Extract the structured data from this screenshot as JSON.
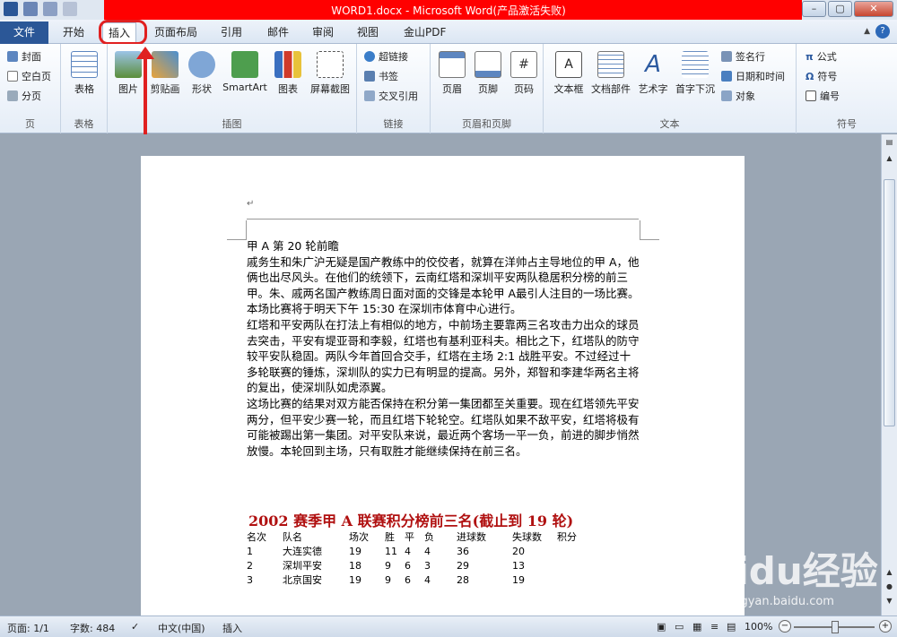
{
  "window": {
    "title": "WORD1.docx - Microsoft Word(产品激活失败)",
    "buttons": [
      "–",
      "▢",
      "✕"
    ]
  },
  "tabs": {
    "file": "文件",
    "items": [
      "开始",
      "插入",
      "页面布局",
      "引用",
      "邮件",
      "审阅",
      "视图",
      "金山PDF"
    ],
    "active": "插入"
  },
  "ribbon": {
    "groups": {
      "pages": {
        "label": "页",
        "items": [
          "封面",
          "空白页",
          "分页"
        ]
      },
      "tables": {
        "label": "表格",
        "items": [
          "表格"
        ]
      },
      "illustrations": {
        "label": "插图",
        "items": [
          "图片",
          "剪贴画",
          "形状",
          "SmartArt",
          "图表",
          "屏幕截图"
        ]
      },
      "links": {
        "label": "链接",
        "items": [
          "超链接",
          "书签",
          "交叉引用"
        ]
      },
      "header_footer": {
        "label": "页眉和页脚",
        "items": [
          "页眉",
          "页脚",
          "页码"
        ]
      },
      "text": {
        "label": "文本",
        "items": [
          "文本框",
          "文档部件",
          "艺术字",
          "首字下沉",
          "签名行",
          "日期和时间",
          "对象"
        ]
      },
      "symbols": {
        "label": "符号",
        "items": [
          "公式",
          "符号",
          "编号"
        ]
      }
    }
  },
  "document": {
    "title": "甲 A 第 20 轮前瞻",
    "paragraphs": [
      "戚务生和朱广沪无疑是国产教练中的佼佼者，就算在洋帅占主导地位的甲 A，他俩也出尽风头。在他们的统领下，云南红塔和深圳平安两队稳居积分榜的前三甲。朱、戚两名国产教练周日面对面的交锋是本轮甲 A最引人注目的一场比赛。本场比赛将于明天下午 15:30 在深圳市体育中心进行。",
      "红塔和平安两队在打法上有相似的地方，中前场主要靠两三名攻击力出众的球员去突击，平安有堤亚哥和李毅，红塔也有基利亚科夫。相比之下，红塔队的防守较平安队稳固。两队今年首回合交手，红塔在主场 2:1 战胜平安。不过经过十多轮联赛的锤炼，深圳队的实力已有明显的提高。另外，郑智和李建华两名主将的复出，使深圳队如虎添翼。",
      "这场比赛的结果对双方能否保持在积分第一集团都至关重要。现在红塔领先平安两分，但平安少赛一轮，而且红塔下轮轮空。红塔队如果不敌平安，红塔将极有可能被踢出第一集团。对平安队来说，最近两个客场一平一负，前进的脚步悄然放慢。本轮回到主场，只有取胜才能继续保持在前三名。"
    ],
    "table_title": "2002 赛季甲 A 联赛积分榜前三名(截止到 19 轮)",
    "table_header": [
      "名次",
      "队名",
      "场次",
      "胜",
      "平",
      "负",
      "进球数",
      "失球数",
      "积分"
    ],
    "rows": [
      [
        "1",
        "大连实德",
        "19",
        "11",
        "4",
        "4",
        "36",
        "20",
        ""
      ],
      [
        "2",
        "深圳平安",
        "18",
        "9",
        "6",
        "3",
        "29",
        "13",
        ""
      ],
      [
        "3",
        "北京国安",
        "19",
        "9",
        "6",
        "4",
        "28",
        "19",
        ""
      ]
    ]
  },
  "status": {
    "page": "页面: 1/1",
    "words": "字数: 484",
    "language": "中文(中国)",
    "mode": "插入",
    "zoom": "100%"
  },
  "watermark": {
    "text": "Baidu经验",
    "url": "jingyan.baidu.com"
  }
}
